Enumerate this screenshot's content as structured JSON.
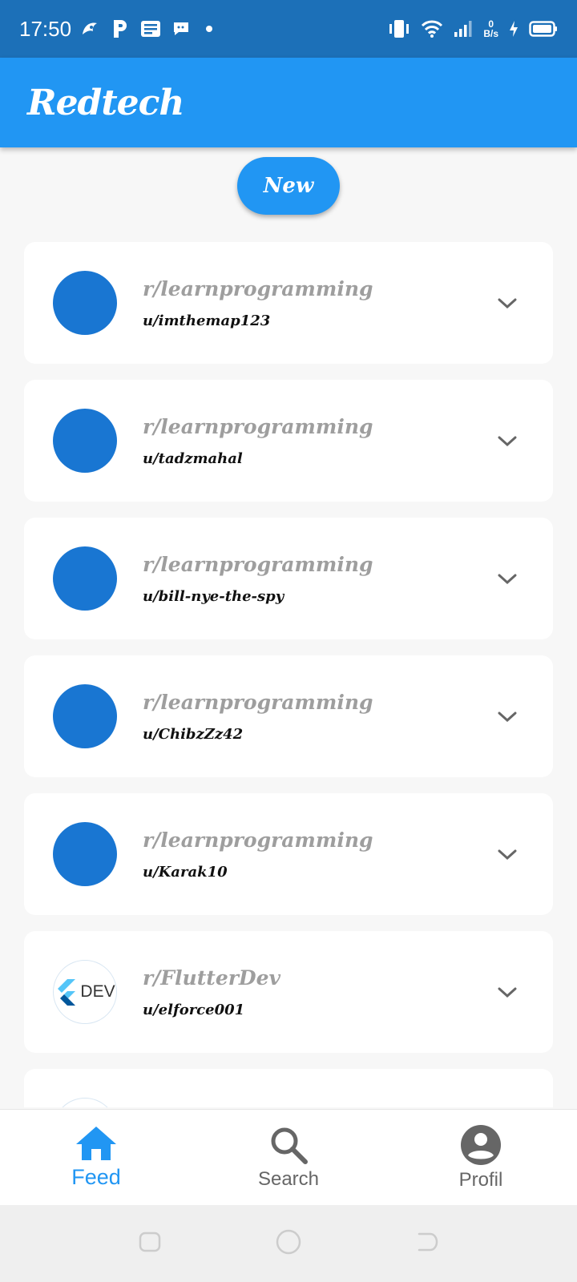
{
  "status_bar": {
    "time": "17:50",
    "net_speed_value": "0",
    "net_speed_unit": "B/s",
    "icons": [
      "app-notification-icon",
      "p-icon",
      "news-icon",
      "message-icon",
      "dot-icon",
      "vibrate-icon",
      "wifi-icon",
      "signal-icon",
      "charging-icon",
      "battery-icon"
    ]
  },
  "app_bar": {
    "title": "Redtech"
  },
  "new_button": {
    "label": "New"
  },
  "feed": {
    "items": [
      {
        "subreddit": "r/learnprogramming",
        "user": "u/imthemap123",
        "avatar": "blue-circle"
      },
      {
        "subreddit": "r/learnprogramming",
        "user": "u/tadzmahal",
        "avatar": "blue-circle"
      },
      {
        "subreddit": "r/learnprogramming",
        "user": "u/bill-nye-the-spy",
        "avatar": "blue-circle"
      },
      {
        "subreddit": "r/learnprogramming",
        "user": "u/ChibzZz42",
        "avatar": "blue-circle"
      },
      {
        "subreddit": "r/learnprogramming",
        "user": "u/Karak10",
        "avatar": "blue-circle"
      },
      {
        "subreddit": "r/FlutterDev",
        "user": "u/elforce001",
        "avatar": "flutter-dev-logo",
        "avatar_text": "DEV"
      }
    ]
  },
  "bottom_nav": {
    "items": [
      {
        "label": "Feed",
        "icon": "home-icon",
        "active": true
      },
      {
        "label": "Search",
        "icon": "search-icon",
        "active": false
      },
      {
        "label": "Profil",
        "icon": "account-circle-icon",
        "active": false
      }
    ]
  },
  "colors": {
    "status_bar": "#1c70b8",
    "primary": "#2196f3",
    "avatar": "#1976d2",
    "subreddit_text": "#9e9e9e"
  }
}
